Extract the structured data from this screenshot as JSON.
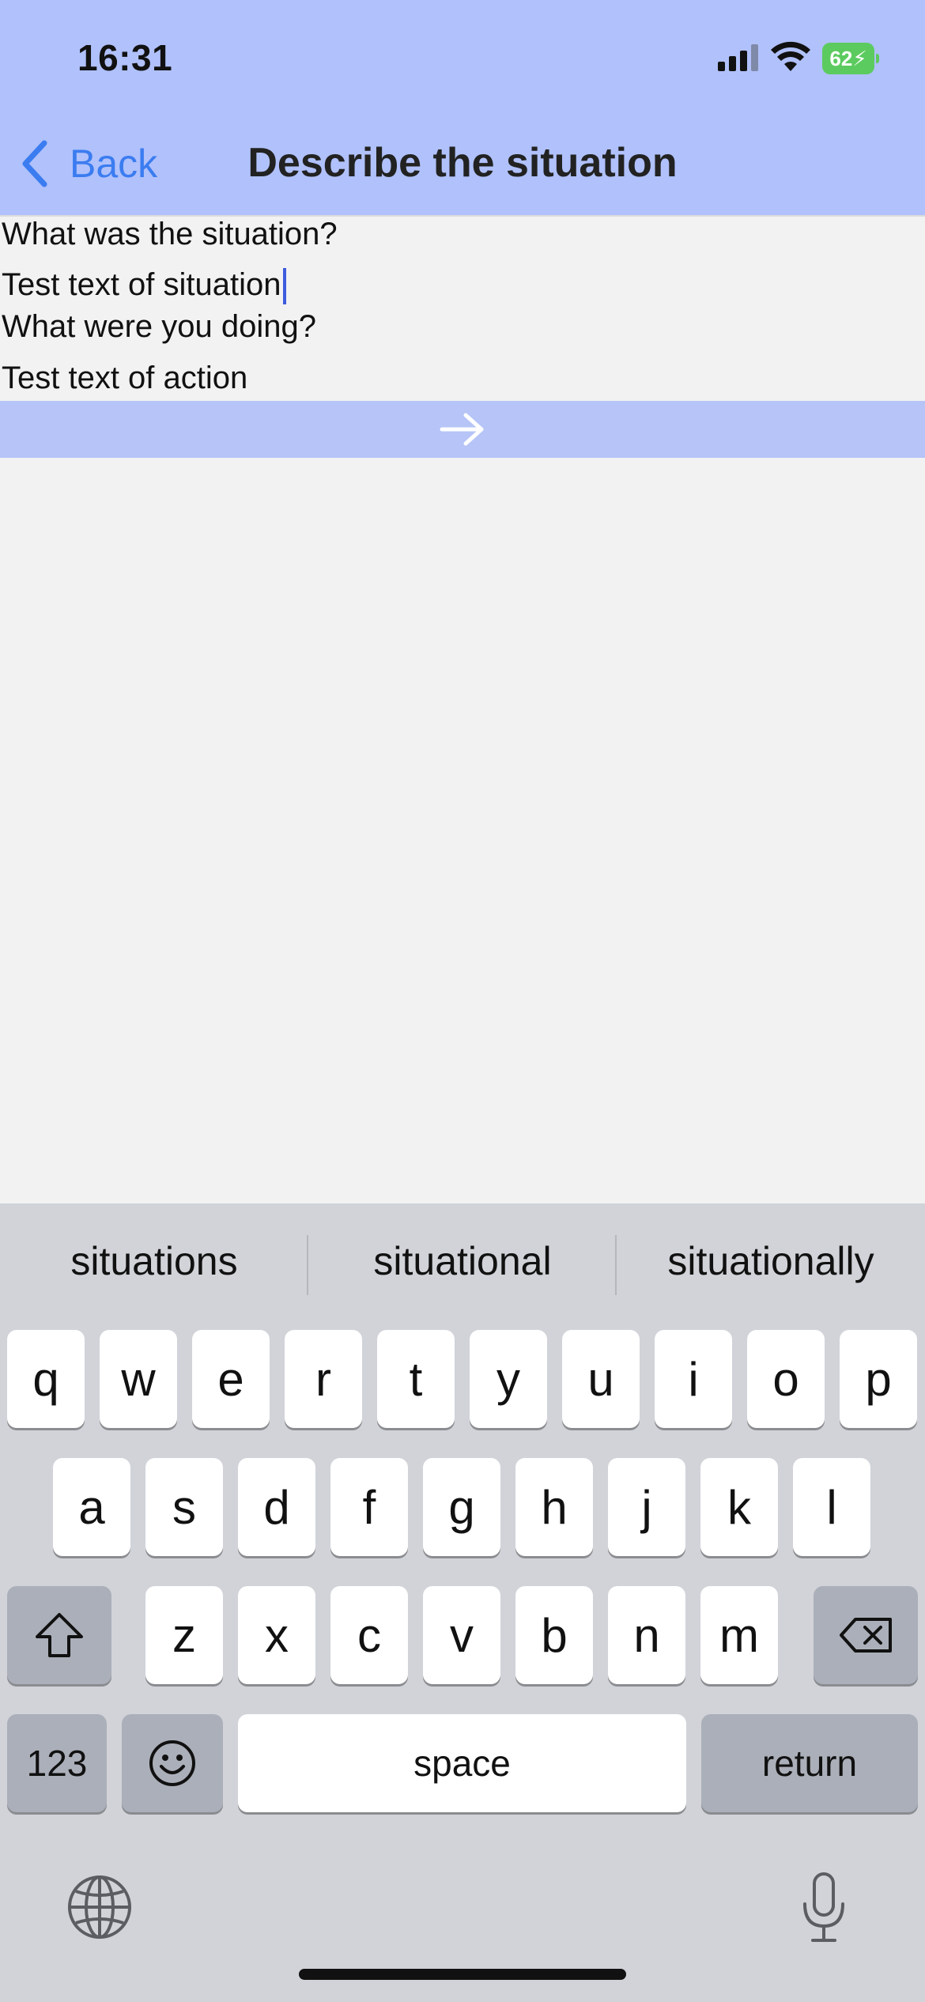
{
  "status_bar": {
    "time": "16:31",
    "battery": "62",
    "battery_color": "#5ccb5f",
    "icons": [
      "signal-icon",
      "wifi-icon",
      "battery-charging-icon"
    ]
  },
  "nav": {
    "back_label": "Back",
    "title": "Describe the situation",
    "accent": "#3b7cf0",
    "header_color": "#b0c1fb"
  },
  "form": {
    "q1": "What was the situation?",
    "a1": "Test text of situation",
    "q2": "What were you doing?",
    "a2": "Test text of action",
    "next_icon": "arrow-right-icon",
    "next_bar_color": "#b6c4f7"
  },
  "keyboard": {
    "suggestions": [
      "situations",
      "situational",
      "situationally"
    ],
    "row1": [
      "q",
      "w",
      "e",
      "r",
      "t",
      "y",
      "u",
      "i",
      "o",
      "p"
    ],
    "row2": [
      "a",
      "s",
      "d",
      "f",
      "g",
      "h",
      "j",
      "k",
      "l"
    ],
    "row3": [
      "z",
      "x",
      "c",
      "v",
      "b",
      "n",
      "m"
    ],
    "numbers": "123",
    "space": "space",
    "return": "return"
  }
}
